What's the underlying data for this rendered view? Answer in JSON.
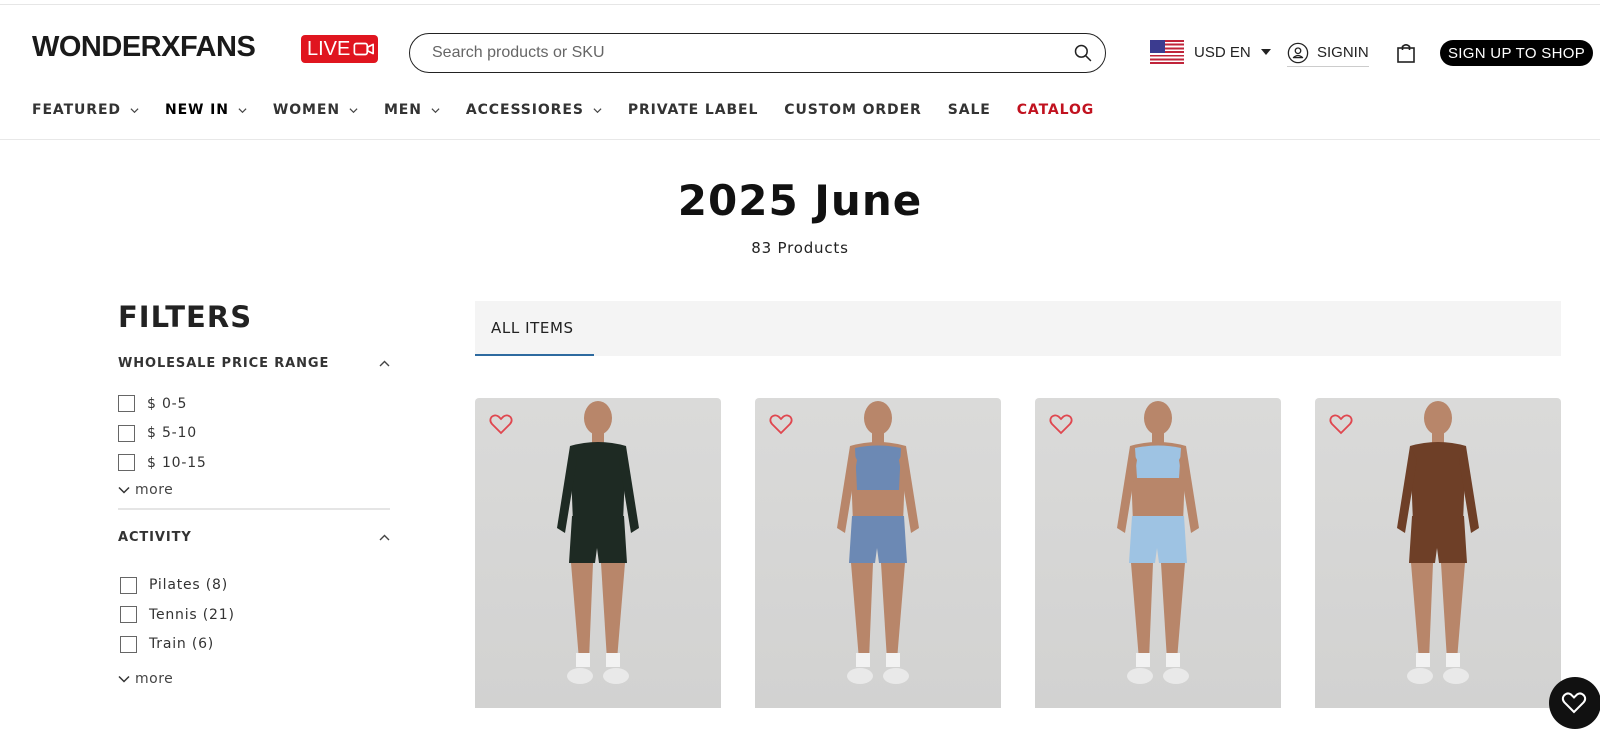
{
  "header": {
    "logo": "WONDERXFANS",
    "live_badge": "LIVE",
    "search": {
      "placeholder": "Search products or SKU"
    },
    "locale": "USD EN",
    "signin": "SIGNIN",
    "signup": "SIGN UP TO SHOP"
  },
  "nav": {
    "items": [
      {
        "label": "FEATURED",
        "dropdown": true
      },
      {
        "label": "NEW IN",
        "dropdown": true
      },
      {
        "label": "WOMEN",
        "dropdown": true
      },
      {
        "label": "MEN",
        "dropdown": true
      },
      {
        "label": "ACCESSIORES",
        "dropdown": true
      },
      {
        "label": "PRIVATE LABEL",
        "dropdown": false
      },
      {
        "label": "CUSTOM ORDER",
        "dropdown": false
      },
      {
        "label": "SALE",
        "dropdown": false
      },
      {
        "label": "CATALOG",
        "dropdown": false
      }
    ]
  },
  "page": {
    "title": "2025 June",
    "product_count": "83 Products"
  },
  "filters": {
    "heading": "FILTERS",
    "price": {
      "title": "WHOLESALE PRICE RANGE",
      "options": [
        "$ 0-5",
        "$ 5-10",
        "$ 10-15"
      ],
      "more": "more"
    },
    "activity": {
      "title": "ACTIVITY",
      "options": [
        "Pilates (8)",
        "Tennis (21)",
        "Train (6)"
      ],
      "more": "more"
    }
  },
  "tabs": {
    "all_items": "ALL ITEMS"
  },
  "products": [
    {
      "outfit": "black long-sleeve unitard with neon green seams",
      "color": "#1e2a23"
    },
    {
      "outfit": "blue halter crop top with shorts set",
      "color": "#6c89b4"
    },
    {
      "outfit": "light blue sports bra with shorts set",
      "color": "#9ec3e3"
    },
    {
      "outfit": "brown zip jacket, bra and shorts set",
      "color": "#6e3f27"
    }
  ],
  "wishlist_count": "0",
  "colors": {
    "live_red": "#e0151f",
    "catalog_red": "#c1121f",
    "tab_underline": "#2d6a9f",
    "heart": "#e0474f"
  }
}
